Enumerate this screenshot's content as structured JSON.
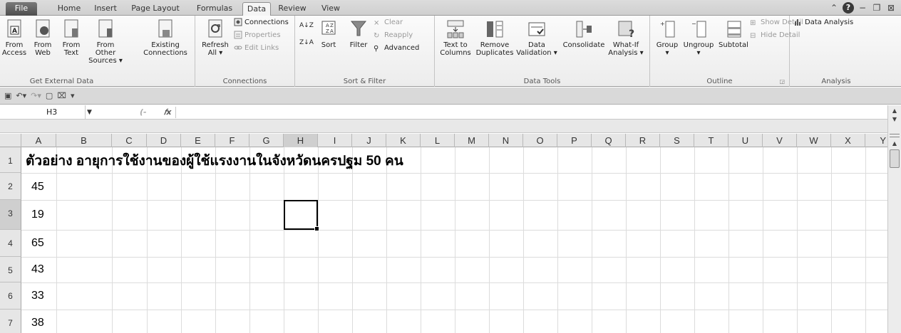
{
  "tabs": [
    {
      "label": "File"
    },
    {
      "label": "Home"
    },
    {
      "label": "Insert"
    },
    {
      "label": "Page Layout"
    },
    {
      "label": "Formulas"
    },
    {
      "label": "Data"
    },
    {
      "label": "Review"
    },
    {
      "label": "View"
    }
  ],
  "active_tab": "Data",
  "window_controls": {
    "help": "?",
    "minimize": "−",
    "restore": "❐",
    "close": "⊠"
  },
  "ribbon": {
    "get_external_data": {
      "label": "Get External Data",
      "buttons": [
        {
          "line1": "From",
          "line2": "Access"
        },
        {
          "line1": "From",
          "line2": "Web"
        },
        {
          "line1": "From",
          "line2": "Text"
        },
        {
          "line1": "From Other",
          "line2": "Sources ▾"
        },
        {
          "line1": "Existing",
          "line2": "Connections"
        }
      ]
    },
    "connections": {
      "label": "Connections",
      "refresh": {
        "line1": "Refresh",
        "line2": "All ▾"
      },
      "small": [
        "Connections",
        "Properties",
        "Edit Links"
      ]
    },
    "sort_filter": {
      "label": "Sort & Filter",
      "sort": "Sort",
      "filter": "Filter",
      "small": [
        "Clear",
        "Reapply",
        "Advanced"
      ]
    },
    "data_tools": {
      "label": "Data Tools",
      "buttons": [
        {
          "line1": "Text to",
          "line2": "Columns"
        },
        {
          "line1": "Remove",
          "line2": "Duplicates"
        },
        {
          "line1": "Data",
          "line2": "Validation ▾"
        },
        {
          "line1": "Consolidate",
          "line2": ""
        },
        {
          "line1": "What-If",
          "line2": "Analysis ▾"
        }
      ]
    },
    "outline": {
      "label": "Outline",
      "buttons": [
        {
          "line1": "Group",
          "line2": "▾"
        },
        {
          "line1": "Ungroup",
          "line2": "▾"
        },
        {
          "line1": "Subtotal",
          "line2": ""
        }
      ],
      "small": [
        "Show Detail",
        "Hide Detail"
      ]
    },
    "analysis": {
      "label": "Analysis",
      "data_analysis": "Data Analysis"
    }
  },
  "formula_bar": {
    "name_box": "H3",
    "fx": "fx",
    "formula": ""
  },
  "columns": [
    "A",
    "B",
    "C",
    "D",
    "E",
    "F",
    "G",
    "H",
    "I",
    "J",
    "K",
    "L",
    "M",
    "N",
    "O",
    "P",
    "Q",
    "R",
    "S",
    "T",
    "U",
    "V",
    "W",
    "X",
    "Y"
  ],
  "rows": [
    "1",
    "2",
    "3",
    "4",
    "5",
    "6",
    "7"
  ],
  "selected_cell": "H3",
  "sheet": {
    "title": "ตัวอย่าง อายุการใช้งานของผู้ใช้แรงงานในจังหวัดนครปฐม 50 คน",
    "values": [
      "45",
      "19",
      "65",
      "43",
      "33",
      "38"
    ]
  }
}
